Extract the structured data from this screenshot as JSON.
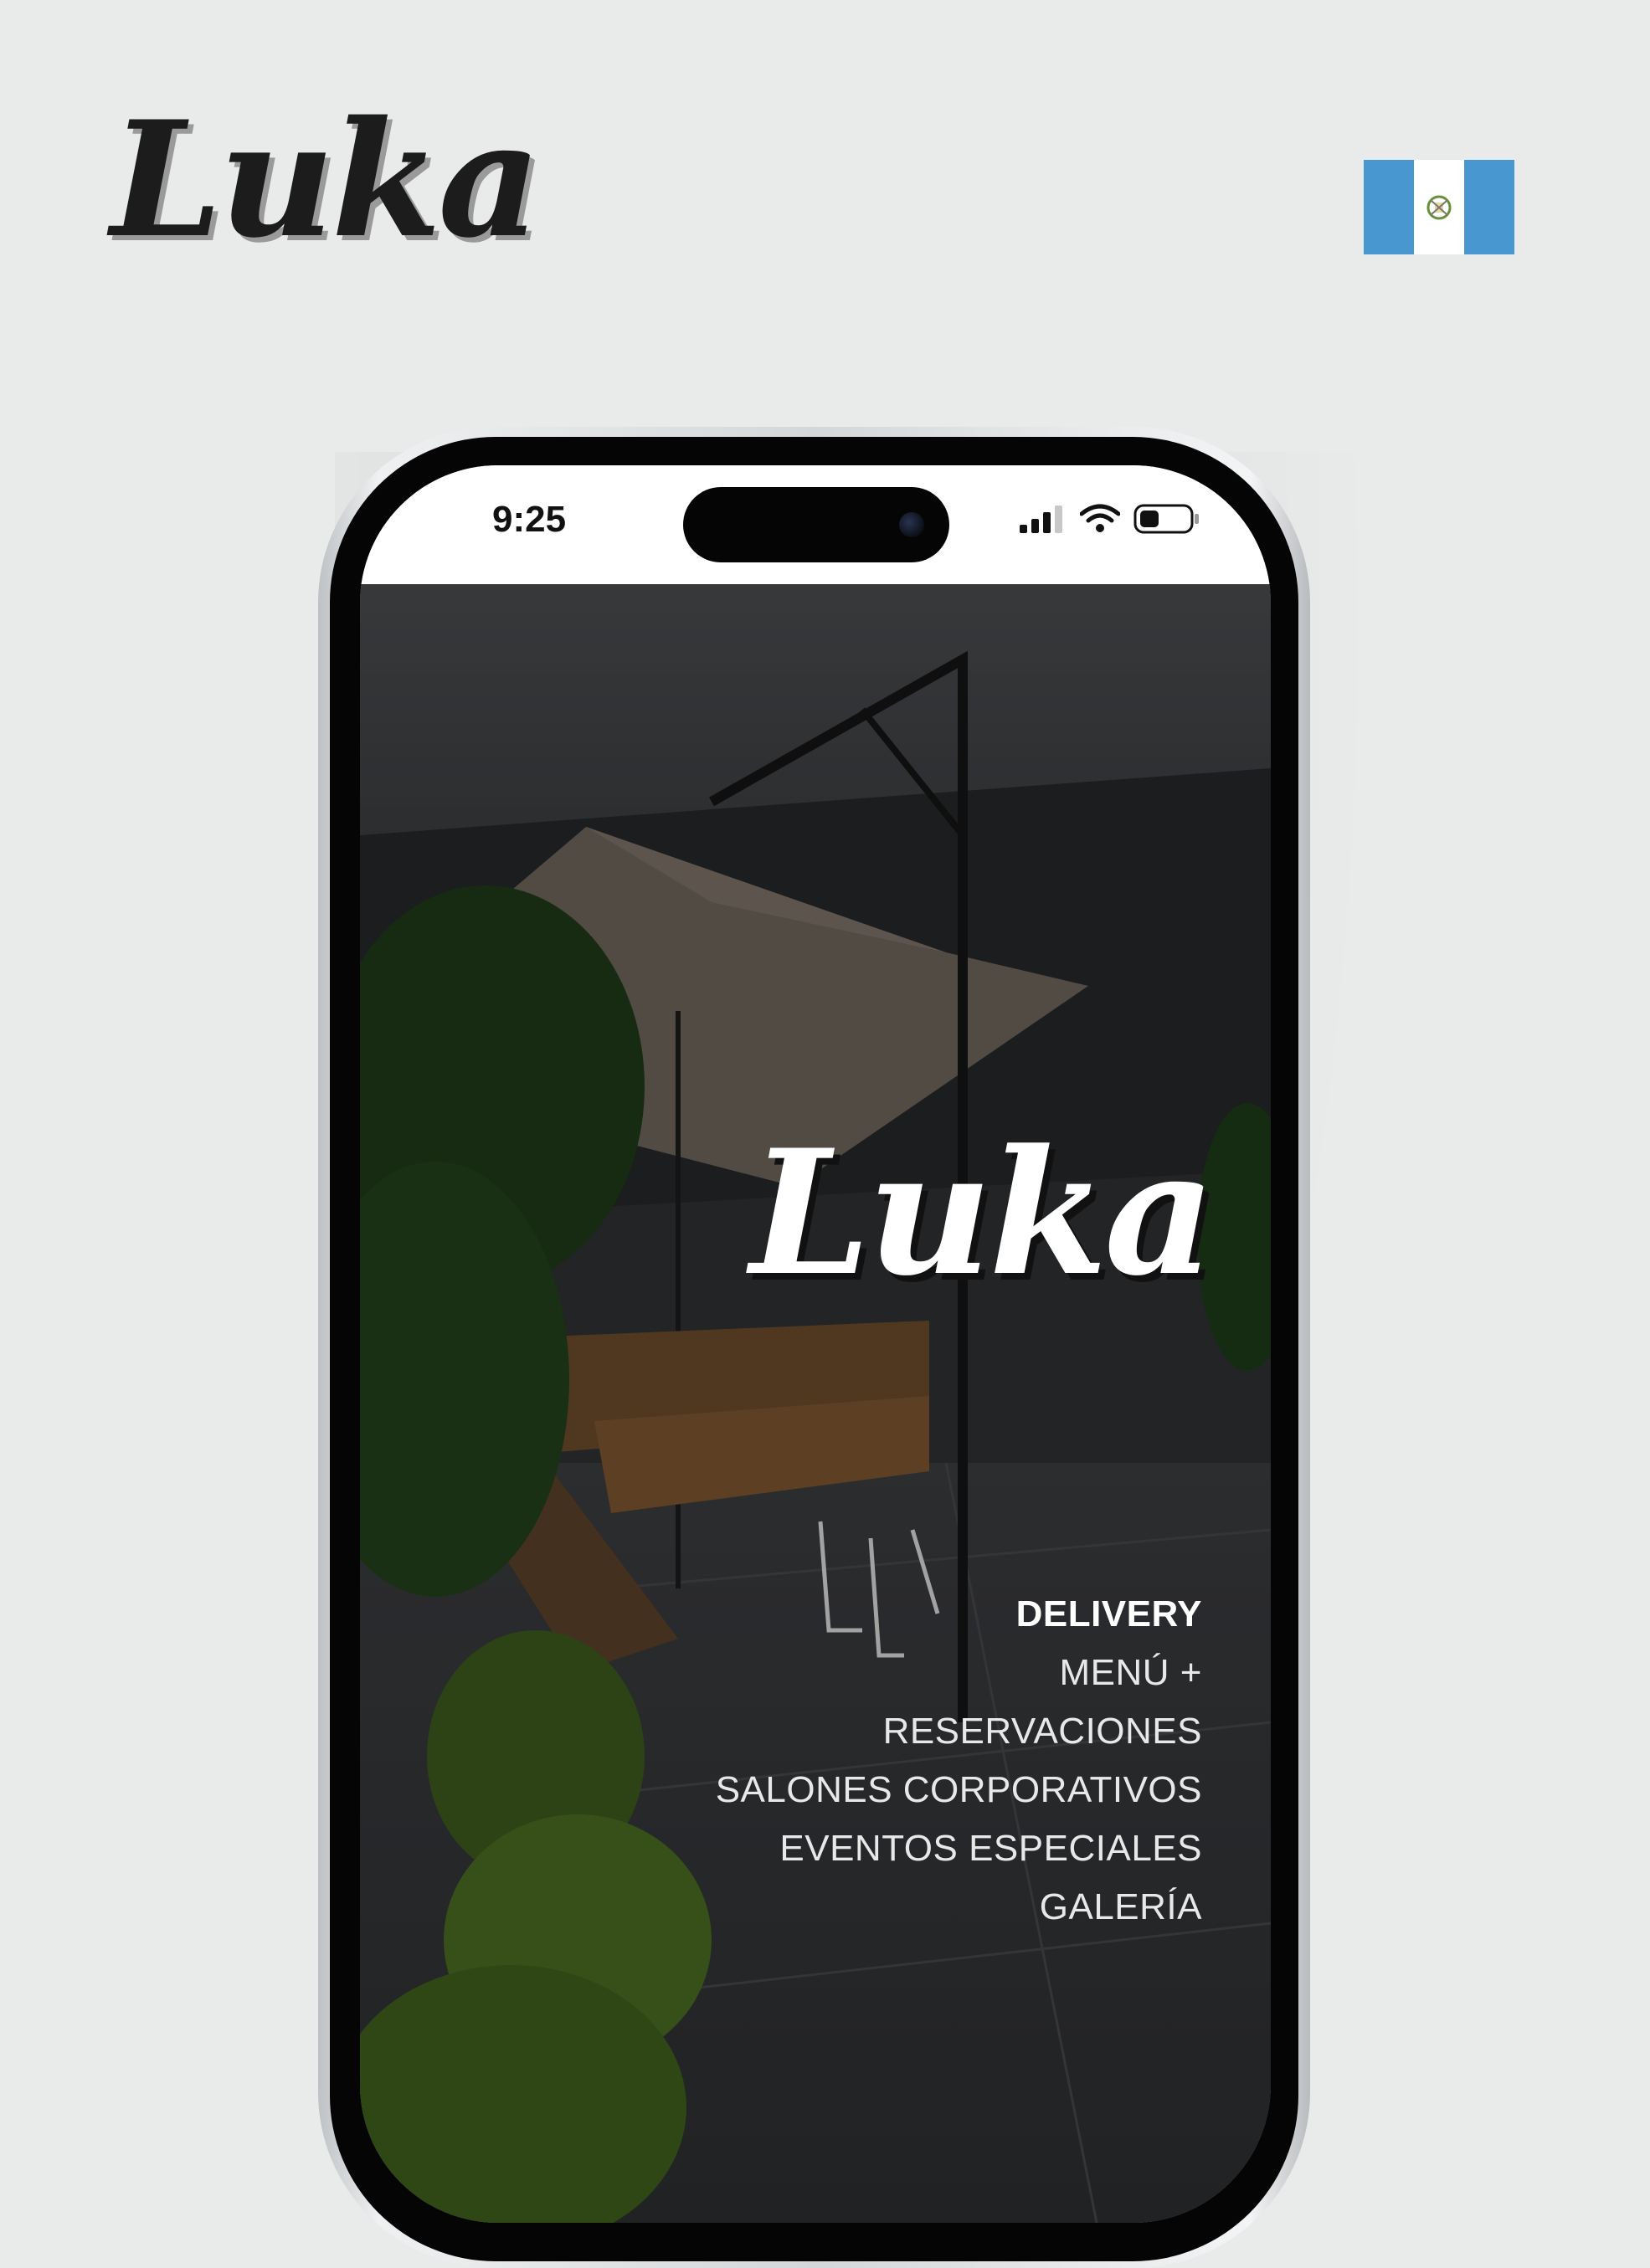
{
  "brand": {
    "logo_text": "Luka"
  },
  "flag": {
    "colors": {
      "blue": "#4997d0",
      "white": "#ffffff"
    }
  },
  "status_bar": {
    "time": "9:25"
  },
  "app": {
    "logo_text": "Luka",
    "nav": {
      "items": [
        {
          "label": "DELIVERY",
          "active": true
        },
        {
          "label": "MENÚ +"
        },
        {
          "label": "RESERVACIONES"
        },
        {
          "label": "SALONES CORPORATIVOS"
        },
        {
          "label": "EVENTOS ESPECIALES"
        },
        {
          "label": "GALERÍA"
        }
      ]
    }
  },
  "colors": {
    "page_background": "#e9ebea",
    "phone_screen_overlay": "#2b2c2c",
    "nav_text": "#ffffff"
  }
}
